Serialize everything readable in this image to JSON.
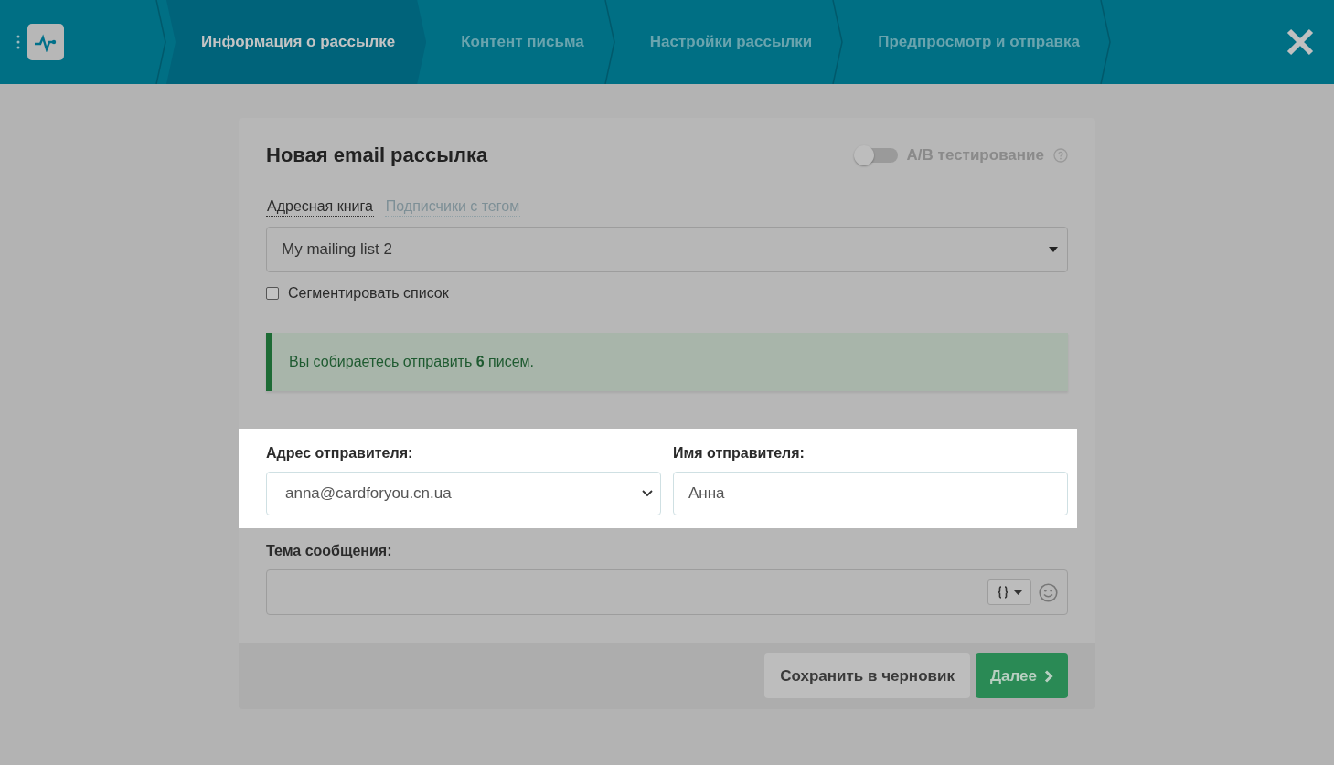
{
  "steps": [
    {
      "label": "Информация о рассылке",
      "selected": true
    },
    {
      "label": "Контент письма",
      "selected": false
    },
    {
      "label": "Настройки рассылки",
      "selected": false
    },
    {
      "label": "Предпросмотр и отправка",
      "selected": false
    }
  ],
  "card": {
    "title": "Новая email рассылка",
    "ab_test": {
      "label": "A/B тестирование",
      "on": false
    },
    "source_tabs": [
      {
        "label": "Адресная книга",
        "selected": true
      },
      {
        "label": "Подписчики с тегом",
        "selected": false
      }
    ],
    "list_select": {
      "value": "My mailing list 2"
    },
    "segment": {
      "label": "Сегментировать список",
      "checked": false
    },
    "alert": {
      "text": "Вы собираетесь отправить **6** писем."
    },
    "sender_address": {
      "label": "Адрес отправителя:",
      "value": "anna@cardforyou.cn.ua"
    },
    "sender_name": {
      "label": "Имя отправителя:",
      "value": "Анна"
    },
    "subject": {
      "label": "Тема сообщения:"
    },
    "buttons": [
      {
        "label": "Сохранить в черновик",
        "kind": "secondary"
      },
      {
        "label": "Далее",
        "kind": "primary"
      }
    ]
  }
}
